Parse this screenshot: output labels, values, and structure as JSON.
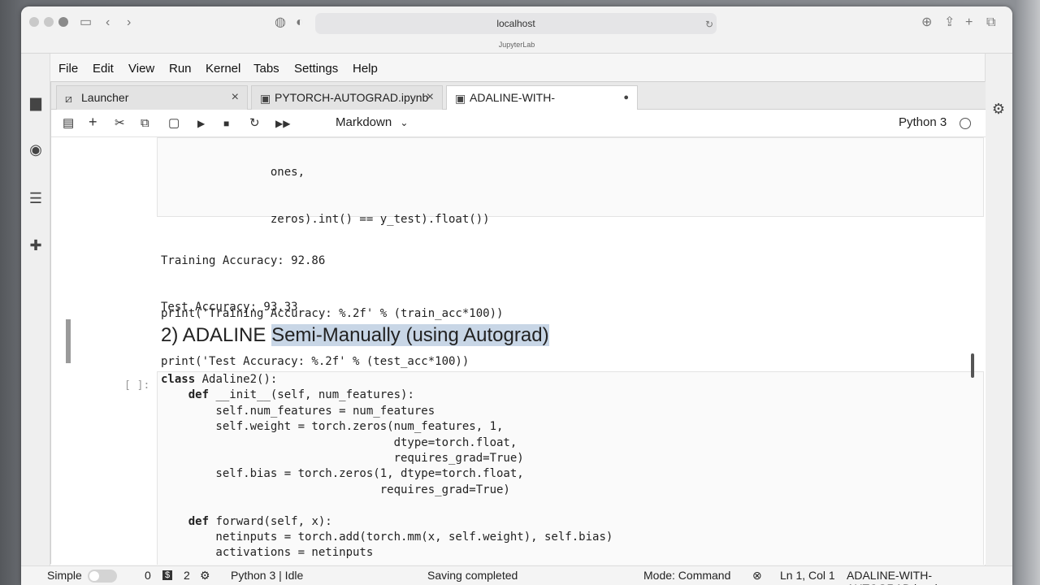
{
  "browser": {
    "url": "localhost",
    "subtitle": "JupyterLab"
  },
  "menu": [
    "File",
    "Edit",
    "View",
    "Run",
    "Kernel",
    "Tabs",
    "Settings",
    "Help"
  ],
  "tabs": [
    {
      "label": "Launcher",
      "icon": "launcher-icon"
    },
    {
      "label": "PYTORCH-AUTOGRAD.ipynb",
      "icon": "notebook-icon"
    },
    {
      "label": "ADALINE-WITH-AUTOGRAD.ipynb",
      "icon": "notebook-icon",
      "active": true,
      "unsaved": true
    }
  ],
  "toolbar": {
    "cell_type": "Markdown",
    "kernel": "Python 3"
  },
  "cell1": {
    "lines": [
      "                ones,",
      "                zeros).int() == y_test).float())",
      "",
      "print('Training Accuracy: %.2f' % (train_acc*100))",
      "print('Test Accuracy: %.2f' % (test_acc*100))"
    ],
    "output": [
      "Training Accuracy: 92.86",
      "Test Accuracy: 93.33"
    ]
  },
  "markdown": {
    "plain": "2) ADALINE ",
    "highlighted": "Semi-Manually (using Autograd)"
  },
  "cell2": {
    "prompt": "[ ]:",
    "lines": [
      [
        "class",
        " Adaline2():"
      ],
      [
        "    def",
        " __init__(self, num_features):"
      ],
      [
        "",
        "        self.num_features = num_features"
      ],
      [
        "",
        "        self.weight = torch.zeros(num_features, 1,"
      ],
      [
        "",
        "                                  dtype=torch.float,"
      ],
      [
        "",
        "                                  requires_grad=True)"
      ],
      [
        "",
        "        self.bias = torch.zeros(1, dtype=torch.float,"
      ],
      [
        "",
        "                                requires_grad=True)"
      ],
      [
        "",
        ""
      ],
      [
        "    def",
        " forward(self, x):"
      ],
      [
        "",
        "        netinputs = torch.add(torch.mm(x, self.weight), self.bias)"
      ],
      [
        "",
        "        activations = netinputs"
      ]
    ]
  },
  "status": {
    "mode_label": "Simple",
    "count1": "0",
    "count2": "2",
    "kernel_status": "Python 3 | Idle",
    "save_status": "Saving completed",
    "mode": "Mode: Command",
    "position": "Ln 1, Col 1",
    "filename": "ADALINE-WITH-AUTOGRAD.ipynb"
  }
}
